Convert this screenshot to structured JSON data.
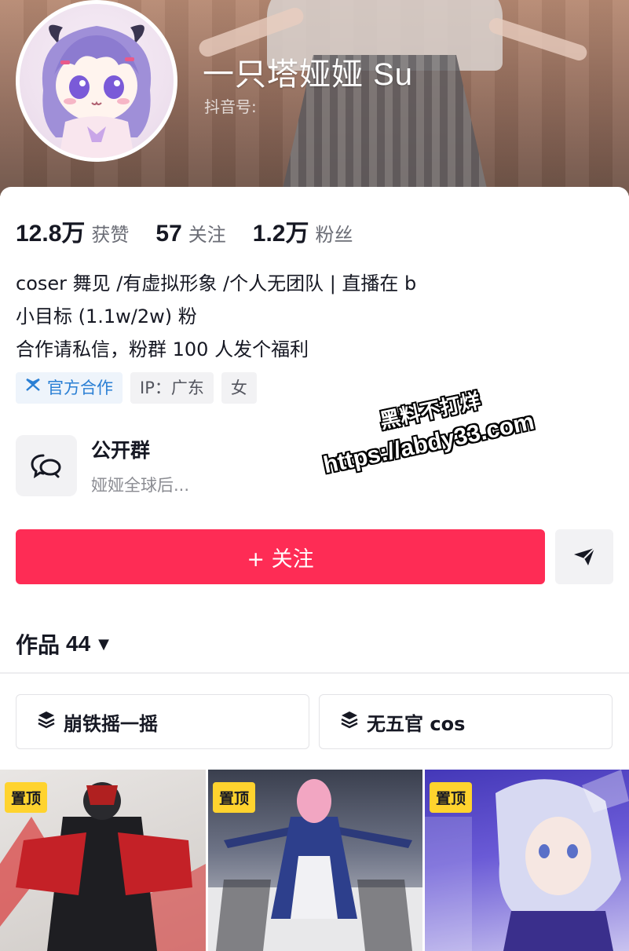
{
  "profile": {
    "name": "一只塔娅娅 Su",
    "douyin_id_label": "抖音号:"
  },
  "stats": [
    {
      "value": "12.8万",
      "label": "获赞"
    },
    {
      "value": "57",
      "label": "关注"
    },
    {
      "value": "1.2万",
      "label": "粉丝"
    }
  ],
  "bio": [
    "coser 舞见 /有虚拟形象 /个人无团队 | 直播在 b",
    "小目标 (1.1w/2w) 粉",
    "合作请私信，粉群 100 人发个福利"
  ],
  "tags": {
    "official": "官方合作",
    "ip": "IP：广东",
    "gender": "女"
  },
  "group": {
    "title": "公开群",
    "subtitle": "娅娅全球后..."
  },
  "actions": {
    "follow_label": "+ 关注"
  },
  "works": {
    "label": "作品",
    "count": "44"
  },
  "collections": [
    {
      "label": "崩铁摇一摇"
    },
    {
      "label": "无五官 cos"
    }
  ],
  "thumbnails": [
    {
      "badge": "置顶"
    },
    {
      "badge": "置顶"
    },
    {
      "badge": "置顶"
    }
  ],
  "watermark": {
    "line1": "黑料不打烊",
    "line2": "https://abdy33.com"
  },
  "colors": {
    "follow": "#fe2c55",
    "pin_badge": "#ffd32e",
    "official_tag": "#2a7fd4"
  },
  "icons": [
    "chat-bubbles-icon",
    "send-icon",
    "caret-down-icon",
    "layers-icon",
    "official-cooperation-icon"
  ]
}
